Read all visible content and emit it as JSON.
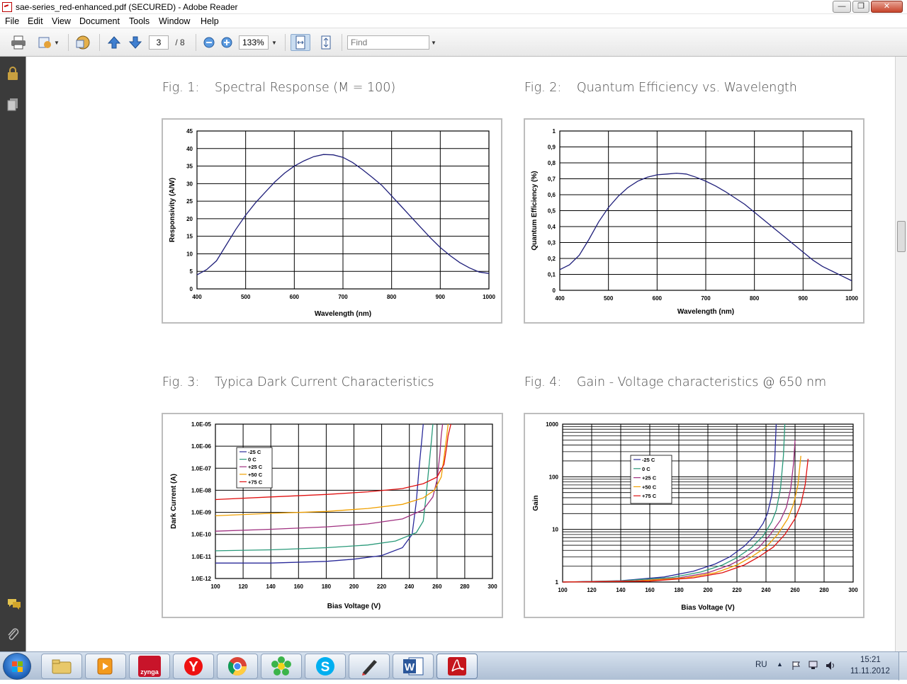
{
  "window": {
    "title": "sae-series_red-enhanced.pdf (SECURED) - Adobe Reader"
  },
  "menu": [
    "File",
    "Edit",
    "View",
    "Document",
    "Tools",
    "Window",
    "Help"
  ],
  "toolbar": {
    "page_current": "3",
    "page_total": "/ 8",
    "zoom": "133%",
    "find_placeholder": "Find"
  },
  "left_pane": {
    "icons": [
      "lock-icon",
      "pages-icon",
      "comment-icon",
      "attachment-icon"
    ]
  },
  "figures": {
    "fig1": {
      "num": "Fig. 1:",
      "title": "Spectral Response (M = 100)"
    },
    "fig2": {
      "num": "Fig. 2:",
      "title": "Quantum Efficiency vs. Wavelength"
    },
    "fig3": {
      "num": "Fig. 3:",
      "title": "Typica Dark Current Characteristics"
    },
    "fig4": {
      "num": "Fig. 4:",
      "title": "Gain - Voltage characteristics @ 650 nm"
    }
  },
  "chart_data": [
    {
      "type": "line",
      "xlabel": "Wavelength (nm)",
      "ylabel": "Responsivity (A/W)",
      "xlim": [
        400,
        1000
      ],
      "ylim": [
        0,
        45
      ],
      "xticks": [
        400,
        500,
        600,
        700,
        800,
        900,
        1000
      ],
      "yticks": [
        0,
        5,
        10,
        15,
        20,
        25,
        30,
        35,
        40,
        45
      ],
      "grid": true,
      "color": "#1f1f7a",
      "x": [
        400,
        420,
        440,
        460,
        480,
        500,
        520,
        540,
        560,
        580,
        600,
        620,
        640,
        660,
        680,
        700,
        720,
        740,
        760,
        780,
        800,
        820,
        840,
        860,
        880,
        900,
        920,
        940,
        960,
        980,
        1000
      ],
      "y": [
        4,
        5.5,
        8,
        12.5,
        17,
        21,
        24.5,
        27.5,
        30.5,
        33,
        35,
        36.5,
        37.7,
        38.3,
        38.2,
        37.5,
        36,
        34,
        31.8,
        29.5,
        26.5,
        23.5,
        20.5,
        17.5,
        14.5,
        11.8,
        9.5,
        7.5,
        6,
        4.8,
        4.4
      ]
    },
    {
      "type": "line",
      "xlabel": "Wavelength (nm)",
      "ylabel": "Quantum Efficiency (%)",
      "xlim": [
        400,
        1000
      ],
      "ylim": [
        0,
        1
      ],
      "xticks": [
        400,
        500,
        600,
        700,
        800,
        900,
        1000
      ],
      "yticks": [
        "0",
        "0,1",
        "0,2",
        "0,3",
        "0,4",
        "0,5",
        "0,6",
        "0,7",
        "0,8",
        "0,9",
        "1"
      ],
      "grid": true,
      "color": "#1f1f7a",
      "x": [
        400,
        420,
        440,
        460,
        480,
        500,
        520,
        540,
        560,
        580,
        600,
        620,
        640,
        660,
        680,
        700,
        720,
        740,
        760,
        780,
        800,
        820,
        840,
        860,
        880,
        900,
        920,
        940,
        960,
        980,
        1000
      ],
      "y": [
        0.13,
        0.16,
        0.22,
        0.32,
        0.43,
        0.52,
        0.59,
        0.645,
        0.685,
        0.71,
        0.725,
        0.73,
        0.735,
        0.73,
        0.71,
        0.685,
        0.655,
        0.62,
        0.58,
        0.54,
        0.49,
        0.44,
        0.39,
        0.34,
        0.29,
        0.24,
        0.19,
        0.15,
        0.12,
        0.09,
        0.06
      ]
    },
    {
      "type": "line",
      "xlabel": "Bias Voltage (V)",
      "ylabel": "Dark Current (A)",
      "xlim": [
        100,
        300
      ],
      "ylim": [
        1e-12,
        1e-05
      ],
      "yscale": "log",
      "xticks": [
        100,
        120,
        140,
        160,
        180,
        200,
        220,
        240,
        260,
        280,
        300
      ],
      "yticks": [
        "1.0E-12",
        "1.0E-11",
        "1.0E-10",
        "1.0E-09",
        "1.0E-08",
        "1.0E-07",
        "1.0E-06",
        "1.0E-05"
      ],
      "grid": true,
      "legend": "top-left",
      "series": [
        {
          "name": "-25 C",
          "color": "#2a2a9a",
          "x": [
            100,
            140,
            180,
            200,
            220,
            235,
            242,
            245,
            247,
            249,
            250
          ],
          "y": [
            5e-12,
            5e-12,
            6e-12,
            7.5e-12,
            1.1e-11,
            2.5e-11,
            1e-10,
            3e-09,
            1e-07,
            2e-06,
            1e-05
          ]
        },
        {
          "name": "0 C",
          "color": "#2a9a7a",
          "x": [
            100,
            140,
            180,
            210,
            230,
            245,
            250,
            252,
            254,
            256,
            257
          ],
          "y": [
            1.8e-11,
            2e-11,
            2.5e-11,
            3.3e-11,
            5e-11,
            1.2e-10,
            4e-10,
            5e-09,
            1e-07,
            2e-06,
            1e-05
          ]
        },
        {
          "name": "+25 C",
          "color": "#a03080",
          "x": [
            100,
            140,
            180,
            210,
            235,
            250,
            257,
            260,
            262,
            263,
            264
          ],
          "y": [
            1.4e-10,
            1.7e-10,
            2.2e-10,
            3e-10,
            5e-10,
            1.3e-09,
            5e-09,
            3e-08,
            4e-07,
            3e-06,
            1e-05
          ]
        },
        {
          "name": "+50 C",
          "color": "#f0a000",
          "x": [
            100,
            140,
            180,
            210,
            235,
            250,
            258,
            263,
            265,
            267,
            268
          ],
          "y": [
            7e-10,
            9e-10,
            1.1e-09,
            1.5e-09,
            2.3e-09,
            4.5e-09,
            1e-08,
            4e-08,
            3e-07,
            3e-06,
            1e-05
          ]
        },
        {
          "name": "+75 C",
          "color": "#e01010",
          "x": [
            100,
            140,
            180,
            210,
            235,
            250,
            260,
            265,
            267,
            268,
            270
          ],
          "y": [
            3.8e-09,
            5e-09,
            6.5e-09,
            8.5e-09,
            1.2e-08,
            2e-08,
            4e-08,
            1.5e-07,
            1e-06,
            3e-06,
            1e-05
          ]
        }
      ]
    },
    {
      "type": "line",
      "xlabel": "Bias Voltage (V)",
      "ylabel": "Gain",
      "xlim": [
        100,
        300
      ],
      "ylim": [
        1,
        1000
      ],
      "yscale": "log",
      "xticks": [
        100,
        120,
        140,
        160,
        180,
        200,
        220,
        240,
        260,
        280,
        300
      ],
      "yticks": [
        "1",
        "10",
        "100",
        "1000"
      ],
      "grid": true,
      "legend": "top-left",
      "series": [
        {
          "name": "-25 C",
          "color": "#2a2a9a",
          "x": [
            100,
            140,
            170,
            190,
            205,
            215,
            225,
            232,
            238,
            241,
            244,
            246,
            247
          ],
          "y": [
            1,
            1.06,
            1.25,
            1.6,
            2.2,
            3,
            4.8,
            7.5,
            13,
            20,
            45,
            200,
            1000
          ]
        },
        {
          "name": "0 C",
          "color": "#2a9a7a",
          "x": [
            100,
            140,
            175,
            195,
            210,
            220,
            230,
            238,
            244,
            247,
            250,
            252,
            253
          ],
          "y": [
            1,
            1.05,
            1.22,
            1.55,
            2.1,
            2.9,
            4.5,
            7.5,
            14,
            23,
            60,
            250,
            1000
          ]
        },
        {
          "name": "+25 C",
          "color": "#a03080",
          "x": [
            100,
            150,
            180,
            200,
            215,
            225,
            235,
            243,
            250,
            254,
            257,
            259,
            260
          ],
          "y": [
            1,
            1.05,
            1.2,
            1.5,
            2.1,
            2.9,
            4.5,
            8,
            15,
            26,
            60,
            180,
            500
          ]
        },
        {
          "name": "+50 C",
          "color": "#f0a000",
          "x": [
            100,
            150,
            185,
            205,
            220,
            230,
            240,
            248,
            255,
            259,
            262,
            264
          ],
          "y": [
            1,
            1.04,
            1.2,
            1.5,
            2.1,
            3,
            4.6,
            8,
            16,
            30,
            70,
            250
          ]
        },
        {
          "name": "+75 C",
          "color": "#e01010",
          "x": [
            100,
            160,
            190,
            210,
            225,
            235,
            245,
            253,
            260,
            264,
            267,
            269
          ],
          "y": [
            1,
            1.04,
            1.2,
            1.5,
            2.1,
            3,
            4.6,
            8,
            16,
            30,
            70,
            220
          ]
        }
      ]
    }
  ],
  "taskbar": {
    "apps": [
      "explorer",
      "media-player",
      "zynga",
      "yandex",
      "chrome",
      "icq",
      "skype",
      "pen-tool",
      "word",
      "adobe-reader"
    ],
    "zynga_label": "zynga",
    "lang": "RU",
    "time": "15:21",
    "date": "11.11.2012"
  },
  "colors": {
    "accent": "#1f1f7a",
    "left_pane": "#3b3b3b"
  }
}
